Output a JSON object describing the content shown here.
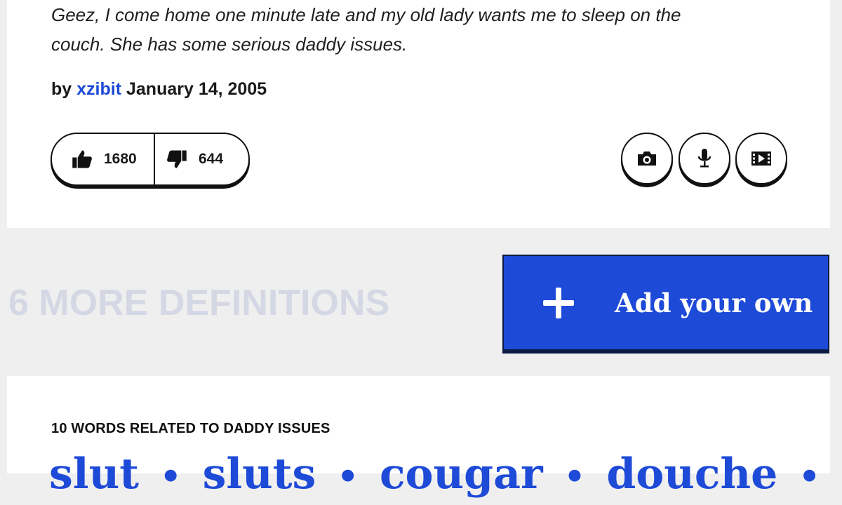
{
  "definition": {
    "example_line1": "Geez, I come home one minute late and my old lady wants me to sleep on the",
    "example_line2": "couch. She has some serious daddy issues.",
    "by_prefix": "by",
    "author": "xzibit",
    "date": "January 14, 2005",
    "upvotes": "1680",
    "downvotes": "644",
    "icons": [
      "thumbs-up-icon",
      "thumbs-down-icon",
      "camera-icon",
      "microphone-icon",
      "video-icon"
    ]
  },
  "more_definitions": "6 MORE DEFINITIONS",
  "add_button": {
    "label": "Add your own",
    "icon": "plus-icon"
  },
  "related": {
    "title": "10 WORDS RELATED TO DADDY ISSUES",
    "words": [
      "slut",
      "sluts",
      "cougar",
      "douche"
    ],
    "separator": "•"
  },
  "colors": {
    "accent_blue": "#1e4ad8",
    "page_bg": "#efefef",
    "muted_heading": "#d5d8e4"
  }
}
